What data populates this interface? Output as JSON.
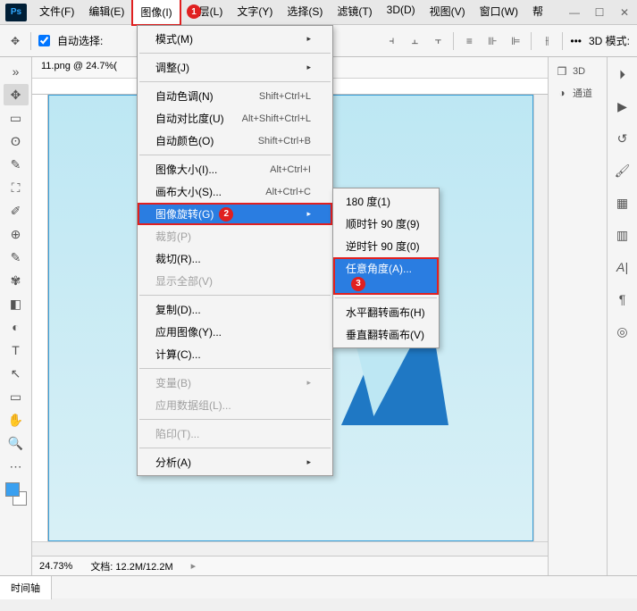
{
  "menubar": {
    "items": [
      "文件(F)",
      "编辑(E)",
      "图像(I)",
      "图层(L)",
      "文字(Y)",
      "选择(S)",
      "滤镜(T)",
      "3D(D)",
      "视图(V)",
      "窗口(W)",
      "帮"
    ]
  },
  "options": {
    "auto_select": "自动选择:",
    "threeD_mode": "3D 模式:"
  },
  "doc": {
    "tab": "11.png @ 24.7%(",
    "zoom": "24.73%",
    "docinfo": "文档: 12.2M/12.2M"
  },
  "panels": {
    "threeD": "3D",
    "channels": "通道"
  },
  "bottom_tab": "时间轴",
  "dropdown": {
    "mode": "模式(M)",
    "adjust": "调整(J)",
    "auto_tone": {
      "label": "自动色调(N)",
      "sc": "Shift+Ctrl+L"
    },
    "auto_contrast": {
      "label": "自动对比度(U)",
      "sc": "Alt+Shift+Ctrl+L"
    },
    "auto_color": {
      "label": "自动颜色(O)",
      "sc": "Shift+Ctrl+B"
    },
    "image_size": {
      "label": "图像大小(I)...",
      "sc": "Alt+Ctrl+I"
    },
    "canvas_size": {
      "label": "画布大小(S)...",
      "sc": "Alt+Ctrl+C"
    },
    "rotation": "图像旋转(G)",
    "crop": "裁剪(P)",
    "trim": "裁切(R)...",
    "reveal_all": "显示全部(V)",
    "duplicate": "复制(D)...",
    "apply_image": "应用图像(Y)...",
    "calculations": "计算(C)...",
    "variables": "变量(B)",
    "apply_dataset": "应用数据组(L)...",
    "trap": "陷印(T)...",
    "analysis": "分析(A)"
  },
  "submenu": {
    "r180": "180 度(1)",
    "r90cw": "顺时针 90 度(9)",
    "r90ccw": "逆时针 90 度(0)",
    "arbitrary": "任意角度(A)...",
    "flip_h": "水平翻转画布(H)",
    "flip_v": "垂直翻转画布(V)"
  },
  "badges": {
    "b1": "1",
    "b2": "2",
    "b3": "3"
  }
}
